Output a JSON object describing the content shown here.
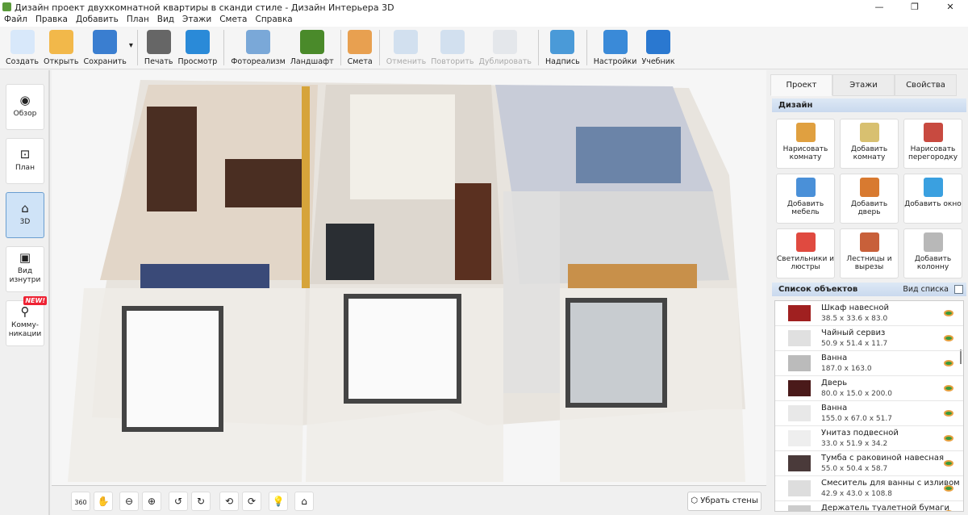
{
  "window": {
    "title": "Дизайн проект двухкомнатной квартиры в сканди стиле - Дизайн Интерьера 3D",
    "minimize": "—",
    "maximize": "❐",
    "close": "✕"
  },
  "menu": [
    "Файл",
    "Правка",
    "Добавить",
    "План",
    "Вид",
    "Этажи",
    "Смета",
    "Справка"
  ],
  "toolbar": [
    {
      "label": "Создать",
      "icon": "new-file-icon",
      "color": "#d8e8fa",
      "enabled": true
    },
    {
      "label": "Открыть",
      "icon": "folder-icon",
      "color": "#f2b84a",
      "enabled": true
    },
    {
      "label": "Сохранить",
      "icon": "floppy-icon",
      "color": "#3a7ed0",
      "enabled": true
    },
    {
      "label": "Печать",
      "icon": "printer-icon",
      "color": "#666",
      "enabled": true
    },
    {
      "label": "Просмотр",
      "icon": "monitor-icon",
      "color": "#2a8ad8",
      "enabled": true
    },
    {
      "label": "Фотореализм",
      "icon": "photo-icon",
      "color": "#7aa8d8",
      "enabled": true
    },
    {
      "label": "Ландшафт",
      "icon": "tree-icon",
      "color": "#4a8a2a",
      "enabled": true
    },
    {
      "label": "Смета",
      "icon": "notepad-icon",
      "color": "#e8a050",
      "enabled": true
    },
    {
      "label": "Отменить",
      "icon": "undo-icon",
      "color": "#a8c8e8",
      "enabled": false
    },
    {
      "label": "Повторить",
      "icon": "redo-icon",
      "color": "#a8c8e8",
      "enabled": false
    },
    {
      "label": "Дублировать",
      "icon": "duplicate-icon",
      "color": "#d0d8e0",
      "enabled": false
    },
    {
      "label": "Надпись",
      "icon": "caption-icon",
      "color": "#4a9ad8",
      "enabled": true
    },
    {
      "label": "Настройки",
      "icon": "gear-icon",
      "color": "#3a8ad8",
      "enabled": true
    },
    {
      "label": "Учебник",
      "icon": "help-icon",
      "color": "#2a78d0",
      "enabled": true
    }
  ],
  "save_dropdown": "▾",
  "sidebar": [
    {
      "label": "Обзор",
      "icon": "eye-icon",
      "glyph": "◉",
      "active": false
    },
    {
      "label": "План",
      "icon": "plan-icon",
      "glyph": "⊡",
      "active": false
    },
    {
      "label": "3D",
      "icon": "house-3d-icon",
      "glyph": "⌂",
      "active": true
    },
    {
      "label": "Вид изнутри",
      "icon": "inside-view-icon",
      "glyph": "▣",
      "active": false
    },
    {
      "label": "Комму-никации",
      "icon": "faucet-icon",
      "glyph": "⚲",
      "active": false,
      "badge": "NEW!"
    }
  ],
  "view_controls": [
    {
      "name": "rotate-360",
      "glyph": "360"
    },
    {
      "name": "pan-hand",
      "glyph": "✋"
    },
    {
      "name": "zoom-out",
      "glyph": "⊖"
    },
    {
      "name": "zoom-in",
      "glyph": "⊕"
    },
    {
      "name": "rotate-left",
      "glyph": "↺"
    },
    {
      "name": "rotate-right",
      "glyph": "↻"
    },
    {
      "name": "tilt-up",
      "glyph": "⟲"
    },
    {
      "name": "tilt-down",
      "glyph": "⟳"
    },
    {
      "name": "light",
      "glyph": "💡"
    },
    {
      "name": "home",
      "glyph": "⌂"
    }
  ],
  "remove_walls": "Убрать стены",
  "right_panel": {
    "tabs": [
      "Проект",
      "Этажи",
      "Свойства"
    ],
    "active_tab": 0,
    "design_header": "Дизайн",
    "design_buttons": [
      {
        "label": "Нарисовать комнату",
        "icon": "draw-room-icon",
        "color": "#e0a040"
      },
      {
        "label": "Добавить комнату",
        "icon": "add-room-icon",
        "color": "#d8c070"
      },
      {
        "label": "Нарисовать перегородку",
        "icon": "brick-wall-icon",
        "color": "#c84a40"
      },
      {
        "label": "Добавить мебель",
        "icon": "armchair-icon",
        "color": "#4a90d8"
      },
      {
        "label": "Добавить дверь",
        "icon": "door-icon",
        "color": "#d87a30"
      },
      {
        "label": "Добавить окно",
        "icon": "window-icon",
        "color": "#3aa0e0"
      },
      {
        "label": "Светильники и люстры",
        "icon": "lamp-icon",
        "color": "#e04a40"
      },
      {
        "label": "Лестницы и вырезы",
        "icon": "stairs-icon",
        "color": "#c8603a"
      },
      {
        "label": "Добавить колонну",
        "icon": "column-icon",
        "color": "#b8b8b8"
      }
    ],
    "objects_header": "Список объектов",
    "list_view": "Вид списка",
    "objects": [
      {
        "name": "Шкаф навесной",
        "dims": "38.5 x 33.6 x 83.0",
        "color": "#a02020"
      },
      {
        "name": "Чайный сервиз",
        "dims": "50.9 x 51.4 x 11.7",
        "color": "#e0e0e0"
      },
      {
        "name": "Ванна",
        "dims": "187.0 x 163.0",
        "color": "#bbbbbb"
      },
      {
        "name": "Дверь",
        "dims": "80.0 x 15.0 x 200.0",
        "color": "#4a1a1a"
      },
      {
        "name": "Ванна",
        "dims": "155.0 x 67.0 x 51.7",
        "color": "#e8e8e8"
      },
      {
        "name": "Унитаз подвесной",
        "dims": "33.0 x 51.9 x 34.2",
        "color": "#eeeeee"
      },
      {
        "name": "Тумба с раковиной навесная",
        "dims": "55.0 x 50.4 x 58.7",
        "color": "#4a3a3a"
      },
      {
        "name": "Смеситель для ванны с изливом",
        "dims": "42.9 x 43.0 x 108.8",
        "color": "#dddddd"
      },
      {
        "name": "Держатель туалетной бумаги",
        "dims": "",
        "color": "#cccccc"
      }
    ]
  }
}
